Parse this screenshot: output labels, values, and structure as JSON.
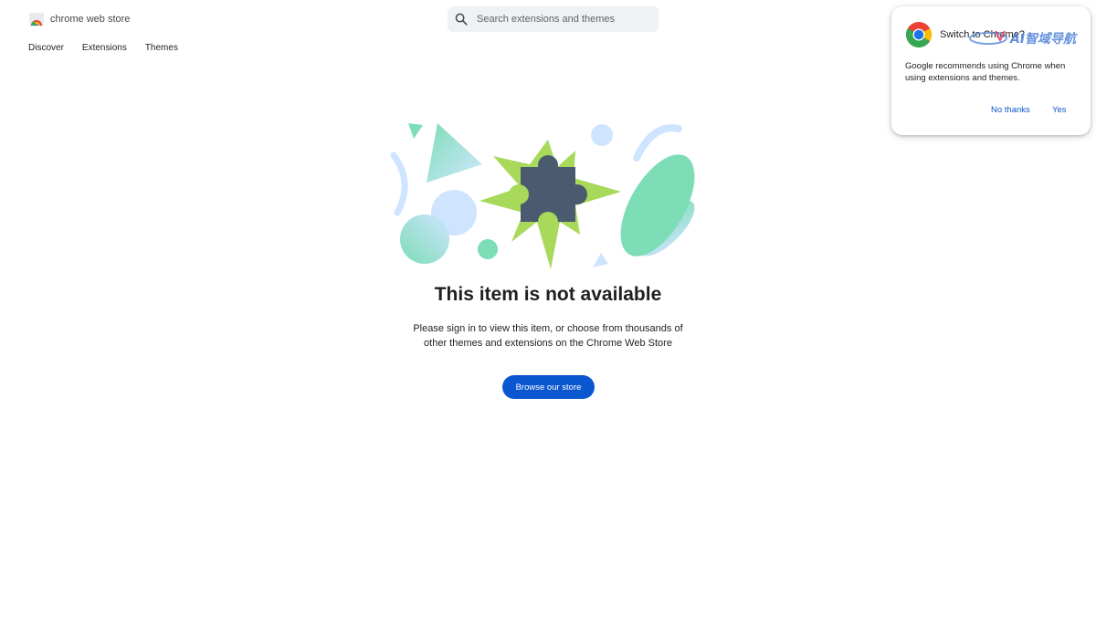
{
  "header": {
    "logo_text": "chrome web store",
    "search_placeholder": "Search extensions and themes",
    "search_icon": "search-icon",
    "nav": [
      "Discover",
      "Extensions",
      "Themes"
    ]
  },
  "main": {
    "illustration_icon": "puzzle-piece-icon",
    "title": "This item is not available",
    "subtitle_line1": "Please sign in to view this item, or choose from thousands of",
    "subtitle_line2": "other themes and extensions on the Chrome Web Store",
    "button_label": "Browse our store"
  },
  "popup": {
    "title": "Switch to Chrome?",
    "body": "Google recommends using Chrome when using extensions and themes.",
    "no_label": "No thanks",
    "yes_label": "Yes",
    "watermark_text": "AI智域导航"
  },
  "colors": {
    "accent": "#0b57d0",
    "search_bg": "#eff1f4",
    "illustration_green": "#a8d95a",
    "illustration_teal": "#7dddb7",
    "illustration_blue": "#cfe4ff",
    "puzzle": "#4a5a6f"
  }
}
